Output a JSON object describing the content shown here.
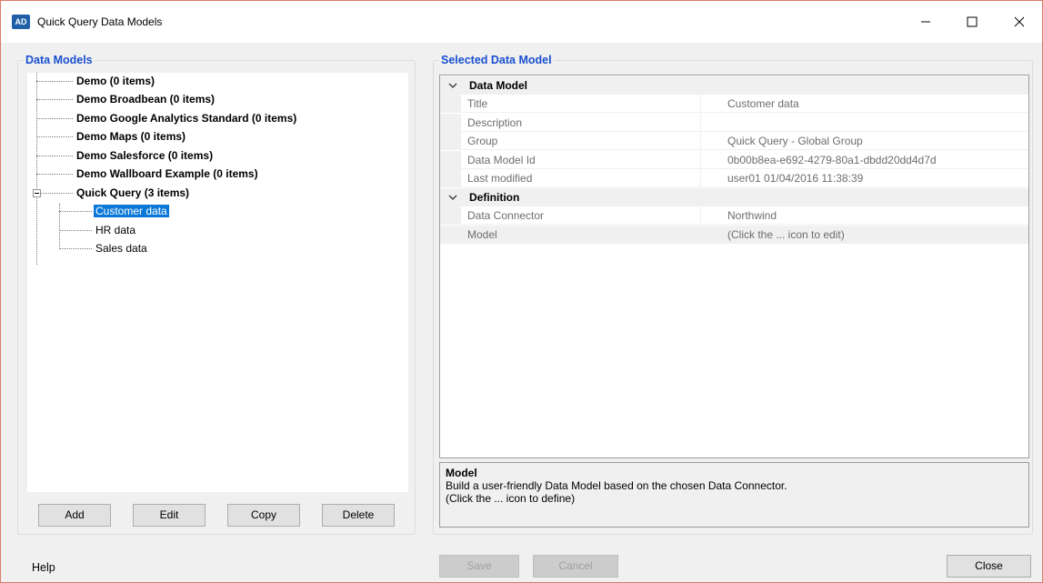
{
  "window": {
    "app_icon_text": "AD",
    "title": "Quick Query Data Models"
  },
  "left_panel": {
    "legend": "Data Models",
    "tree": [
      {
        "label": "Demo (0 items)",
        "bold": true,
        "level": 0
      },
      {
        "label": "Demo Broadbean (0 items)",
        "bold": true,
        "level": 0
      },
      {
        "label": "Demo Google Analytics Standard  (0 items)",
        "bold": true,
        "level": 0
      },
      {
        "label": "Demo Maps (0 items)",
        "bold": true,
        "level": 0
      },
      {
        "label": "Demo Salesforce (0 items)",
        "bold": true,
        "level": 0
      },
      {
        "label": "Demo Wallboard Example (0 items)",
        "bold": true,
        "level": 0
      },
      {
        "label": "Quick Query (3 items)",
        "bold": true,
        "level": 0,
        "expanded": true
      },
      {
        "label": "Customer data",
        "bold": false,
        "level": 1,
        "selected": true
      },
      {
        "label": "HR data",
        "bold": false,
        "level": 1
      },
      {
        "label": "Sales data",
        "bold": false,
        "level": 1
      }
    ],
    "buttons": {
      "add": "Add",
      "edit": "Edit",
      "copy": "Copy",
      "delete": "Delete"
    }
  },
  "right_panel": {
    "legend": "Selected Data Model",
    "categories": [
      {
        "name": "Data Model",
        "properties": [
          {
            "name": "Title",
            "value": "Customer data"
          },
          {
            "name": "Description",
            "value": ""
          },
          {
            "name": "Group",
            "value": "Quick Query - Global Group"
          },
          {
            "name": "Data Model Id",
            "value": "0b00b8ea-e692-4279-80a1-dbdd20dd4d7d"
          },
          {
            "name": "Last modified",
            "value": "user01 01/04/2016 11:38:39"
          }
        ]
      },
      {
        "name": "Definition",
        "properties": [
          {
            "name": "Data Connector",
            "value": "Northwind"
          },
          {
            "name": "Model",
            "value": "(Click the ... icon to edit)"
          }
        ]
      }
    ],
    "description": {
      "title": "Model",
      "line1": "Build a user-friendly Data Model based on the chosen Data Connector.",
      "line2": "(Click the ... icon to define)"
    }
  },
  "footer": {
    "help": "Help",
    "save": "Save",
    "cancel": "Cancel",
    "close": "Close"
  }
}
